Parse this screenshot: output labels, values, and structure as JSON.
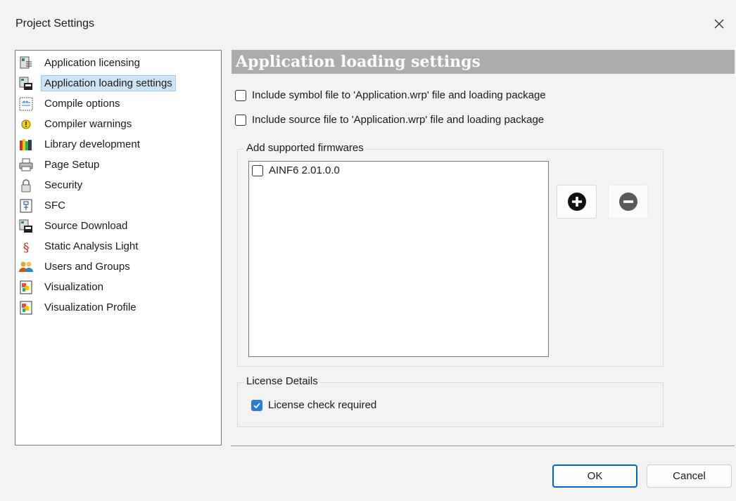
{
  "window": {
    "title": "Project Settings"
  },
  "tree": {
    "items": [
      {
        "label": "Application licensing",
        "icon": "license-icon"
      },
      {
        "label": "Application loading settings",
        "icon": "loading-settings-icon",
        "selected": true
      },
      {
        "label": "Compile options",
        "icon": "compile-options-icon"
      },
      {
        "label": "Compiler warnings",
        "icon": "warning-icon"
      },
      {
        "label": "Library development",
        "icon": "library-icon"
      },
      {
        "label": "Page Setup",
        "icon": "printer-icon"
      },
      {
        "label": "Security",
        "icon": "lock-icon"
      },
      {
        "label": "SFC",
        "icon": "sfc-icon"
      },
      {
        "label": "Source Download",
        "icon": "source-download-icon"
      },
      {
        "label": "Static Analysis Light",
        "icon": "paragraph-icon"
      },
      {
        "label": "Users and Groups",
        "icon": "users-icon"
      },
      {
        "label": "Visualization",
        "icon": "visualization-icon"
      },
      {
        "label": "Visualization Profile",
        "icon": "visualization-profile-icon"
      }
    ]
  },
  "panel": {
    "header": "Application loading settings",
    "include_symbol": {
      "label": "Include symbol file to 'Application.wrp' file and loading package",
      "checked": false
    },
    "include_source": {
      "label": "Include source file to 'Application.wrp' file and loading package",
      "checked": false
    },
    "firmwares": {
      "title": "Add supported firmwares",
      "items": [
        {
          "label": "AINF6 2.01.0.0",
          "checked": false
        }
      ]
    },
    "license": {
      "title": "License Details",
      "check": {
        "label": "License check required",
        "checked": true
      }
    }
  },
  "buttons": {
    "ok": "OK",
    "cancel": "Cancel"
  },
  "colors": {
    "accent": "#0067c0",
    "header_bg": "#acacac",
    "selection": "#cce4f7",
    "checkbox_checked": "#2a7bd3"
  }
}
